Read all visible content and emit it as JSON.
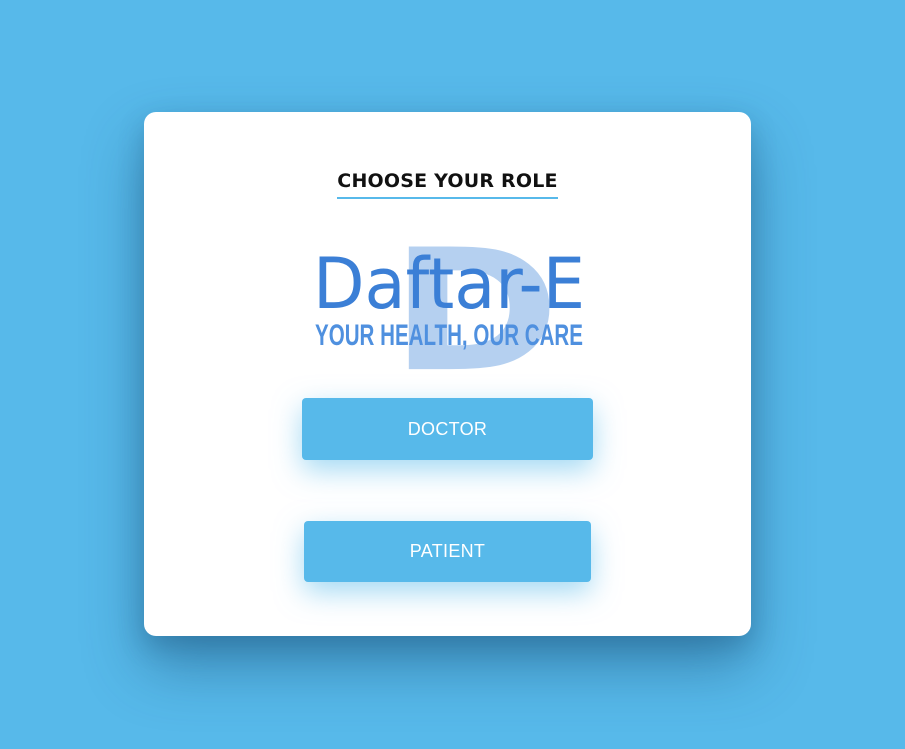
{
  "card": {
    "title": "CHOOSE YOUR ROLE"
  },
  "logo": {
    "name": "Daftar-E",
    "tagline": "YOUR HEALTH, OUR CARE",
    "letter": "D"
  },
  "buttons": {
    "doctor": "DOCTOR",
    "patient": "PATIENT"
  },
  "colors": {
    "background": "#57b9ea",
    "card": "#ffffff",
    "logo_text": "#3b7fd6",
    "logo_letter": "#b5d0f0",
    "button": "#57b9ea",
    "title_underline": "#57b9ea"
  }
}
